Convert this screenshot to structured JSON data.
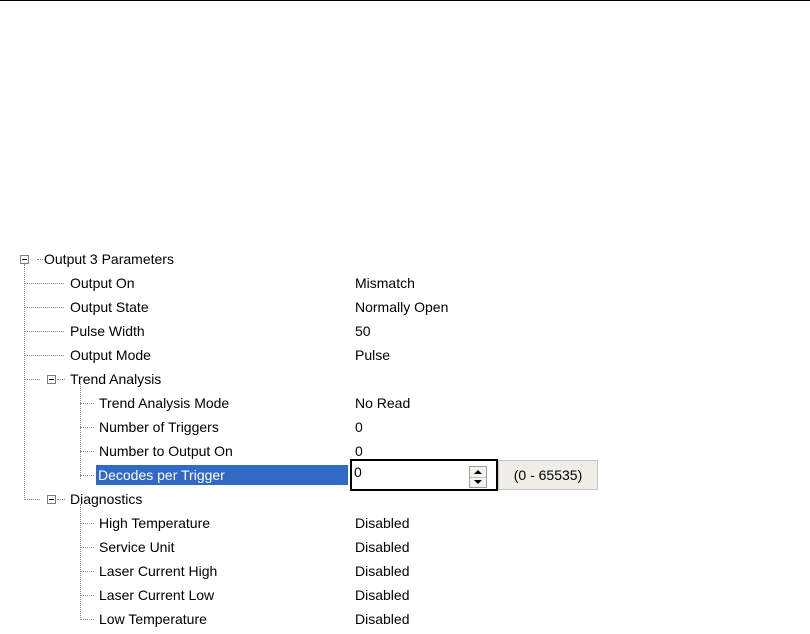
{
  "tree": {
    "root": {
      "label": "Output 3 Parameters"
    },
    "items": [
      {
        "label": "Output On",
        "value": "Mismatch"
      },
      {
        "label": "Output State",
        "value": "Normally Open"
      },
      {
        "label": "Pulse Width",
        "value": "50"
      },
      {
        "label": "Output Mode",
        "value": "Pulse"
      }
    ],
    "trend": {
      "label": "Trend Analysis",
      "items": [
        {
          "label": "Trend Analysis Mode",
          "value": "No Read"
        },
        {
          "label": "Number of Triggers",
          "value": "0"
        },
        {
          "label": "Number to Output On",
          "value": "0"
        },
        {
          "label": "Decodes per Trigger",
          "value": "0"
        }
      ]
    },
    "diagnostics": {
      "label": "Diagnostics",
      "items": [
        {
          "label": "High Temperature",
          "value": "Disabled"
        },
        {
          "label": "Service Unit",
          "value": "Disabled"
        },
        {
          "label": "Laser Current High",
          "value": "Disabled"
        },
        {
          "label": "Laser Current Low",
          "value": "Disabled"
        },
        {
          "label": "Low Temperature",
          "value": "Disabled"
        }
      ]
    }
  },
  "editor": {
    "value": "0",
    "range_hint": "(0 - 65535)",
    "spin_up_icon": "spin-up-arrow-icon",
    "spin_down_icon": "spin-down-arrow-icon"
  },
  "colors": {
    "selection": "#316ac5",
    "selection_text": "#ffffff",
    "hint_background": "#efeee6"
  }
}
